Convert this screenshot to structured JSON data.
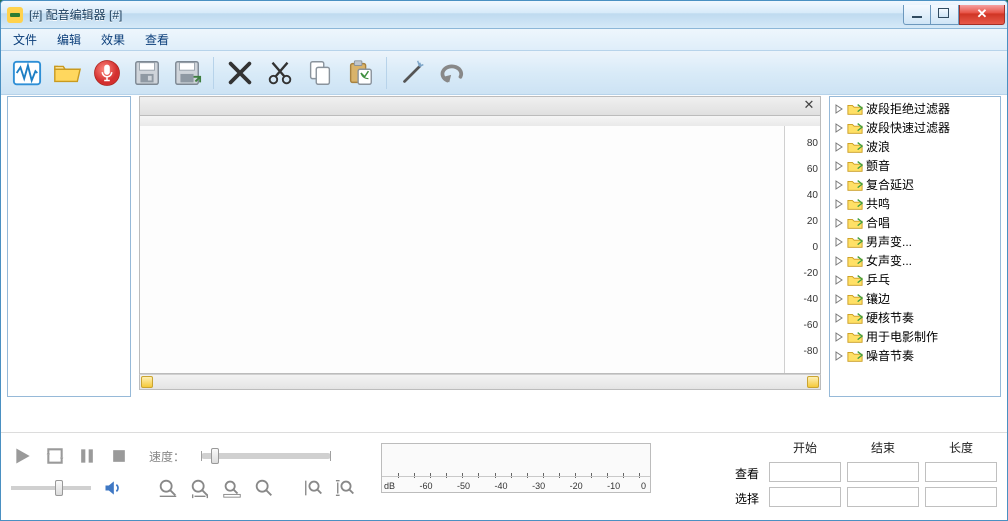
{
  "window": {
    "title": "[#] 配音编辑器 [#]"
  },
  "menu": {
    "file": "文件",
    "edit": "编辑",
    "effects": "效果",
    "view": "查看"
  },
  "toolbar": {
    "new": "new",
    "open": "open",
    "record": "record",
    "save": "save",
    "saveas": "save-as",
    "cut": "cut",
    "scissors": "scissors",
    "copy": "copy",
    "paste": "paste",
    "wand": "wand",
    "undo": "undo"
  },
  "wave_ruler": {
    "ticks": [
      "80",
      "60",
      "40",
      "20",
      "0",
      "-20",
      "-40",
      "-60",
      "-80"
    ]
  },
  "tree": {
    "items": [
      "波段拒绝过滤器",
      "波段快速过滤器",
      "波浪",
      "颤音",
      "复合延迟",
      "共鸣",
      "合唱",
      "男声变...",
      "女声变...",
      "乒乓",
      "镶边",
      "硬核节奏",
      "用于电影制作",
      "噪音节奏"
    ]
  },
  "playback": {
    "speed_label": "速度："
  },
  "meter": {
    "unit": "dB",
    "ticks": [
      "-60",
      "-50",
      "-40",
      "-30",
      "-20",
      "-10",
      "0"
    ]
  },
  "range": {
    "headers": {
      "start": "开始",
      "end": "结束",
      "length": "长度"
    },
    "rows": {
      "view": "查看",
      "select": "选择"
    }
  }
}
